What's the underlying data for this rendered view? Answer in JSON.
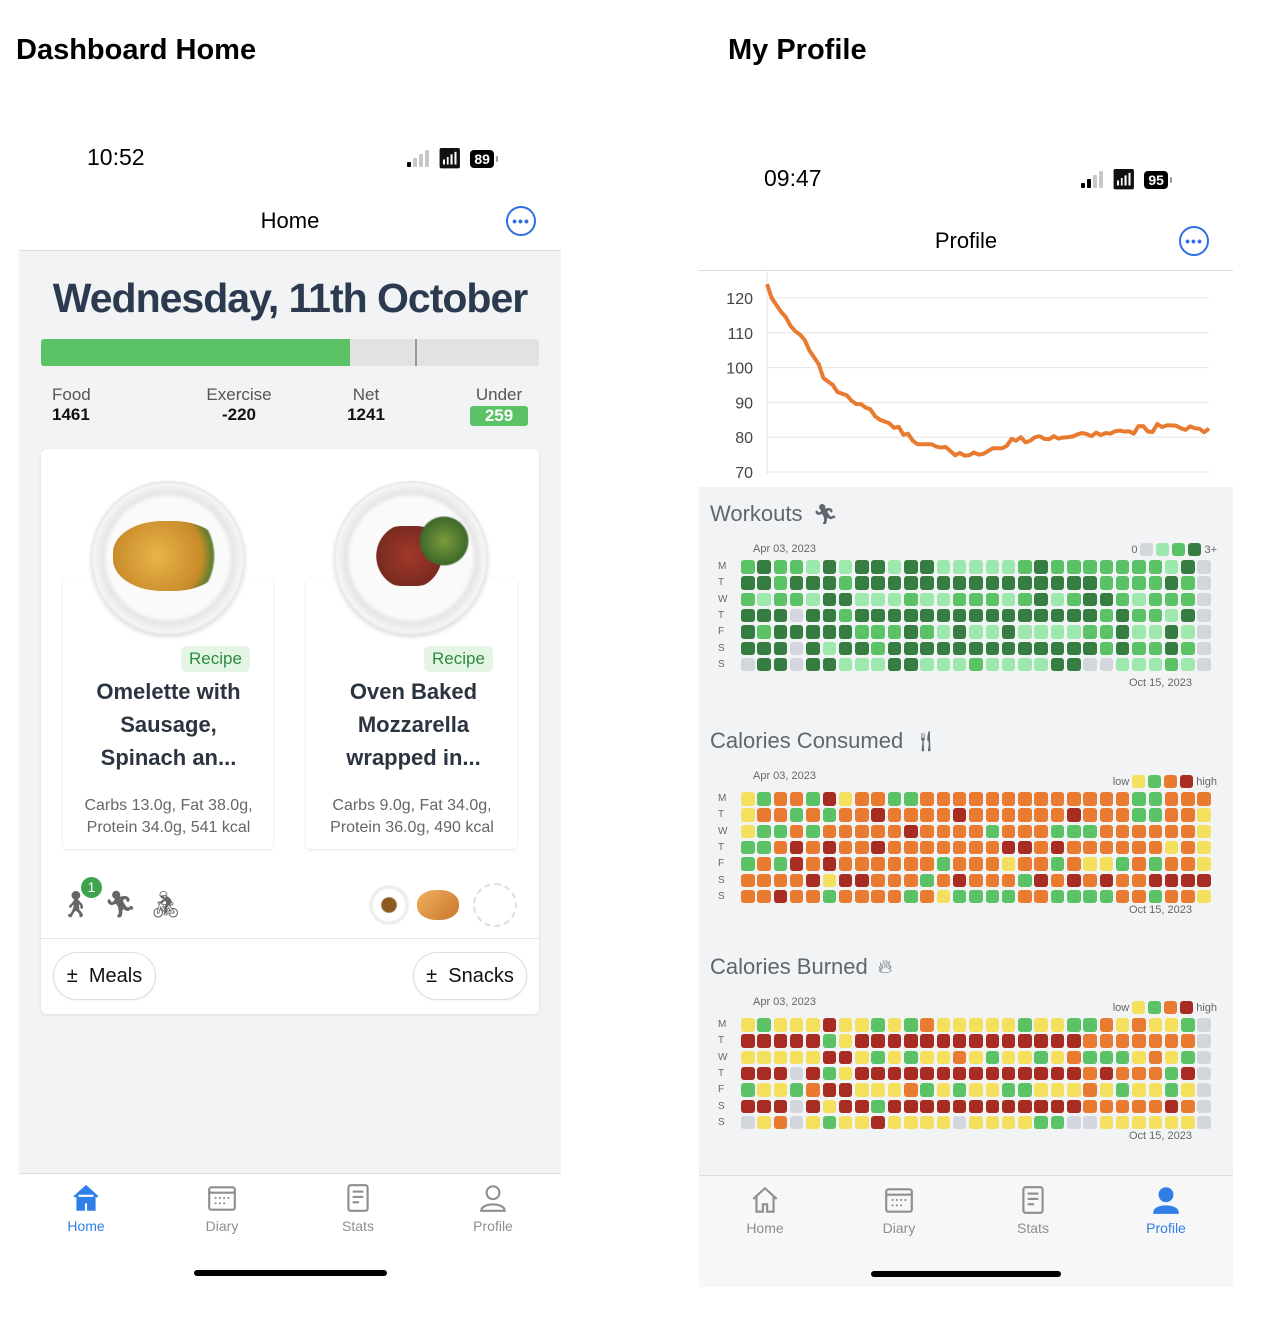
{
  "page_titles": {
    "left": "Dashboard Home",
    "right": "My Profile"
  },
  "home": {
    "status": {
      "time": "10:52",
      "battery": "89"
    },
    "nav_title": "Home",
    "date_title": "Wednesday, 11th October",
    "progress": {
      "food_fraction": 0.62,
      "goal_marker_fraction": 0.75
    },
    "stats": [
      {
        "label": "Food",
        "value": "1461"
      },
      {
        "label": "Exercise",
        "value": "-220"
      },
      {
        "label": "Net",
        "value": "1241"
      },
      {
        "label": "Under",
        "value": "259"
      }
    ],
    "meals": [
      {
        "badge": "Recipe",
        "title": "Omelette with Sausage, Spinach an...",
        "macros": "Carbs 13.0g, Fat 38.0g, Protein 34.0g, 541 kcal"
      },
      {
        "badge": "Recipe",
        "title": "Oven Baked Mozzarella wrapped in...",
        "macros": "Carbs 9.0g, Fat 34.0g, Protein 36.0g, 490 kcal"
      }
    ],
    "activity_badge": "1",
    "activity_icons": [
      "walking-icon",
      "running-icon",
      "cycling-icon"
    ],
    "snack_icons": [
      "coffee-icon",
      "pastry-icon",
      "empty-slot-icon"
    ],
    "buttons": {
      "meals": "Meals",
      "snacks": "Snacks",
      "plusminus": "±"
    },
    "tabs": [
      {
        "label": "Home",
        "icon": "home-icon",
        "active": true
      },
      {
        "label": "Diary",
        "icon": "calendar-icon"
      },
      {
        "label": "Stats",
        "icon": "document-icon"
      },
      {
        "label": "Profile",
        "icon": "person-icon"
      }
    ]
  },
  "profile": {
    "status": {
      "time": "09:47",
      "battery": "95"
    },
    "nav_title": "Profile",
    "tabs": [
      {
        "label": "Home",
        "icon": "home-icon"
      },
      {
        "label": "Diary",
        "icon": "calendar-icon"
      },
      {
        "label": "Stats",
        "icon": "document-icon"
      },
      {
        "label": "Profile",
        "icon": "person-icon",
        "active": true
      }
    ],
    "day_labels": [
      "M",
      "T",
      "W",
      "T",
      "F",
      "S",
      "S"
    ],
    "heatmaps": [
      {
        "title": "Workouts",
        "icon": "running-icon",
        "start": "Apr 03, 2023",
        "end": "Oct 15, 2023",
        "legend_low": "0",
        "legend_high": "3+",
        "palette": [
          "#d3d6dc",
          "#9de8ad",
          "#5cc266",
          "#367d42"
        ],
        "rows": [
          "23221313313311111232222222130",
          "33233323333333333333332222320",
          "21221331112112221231233212220",
          "33303323333333333333332322130",
          "32333332223213113111122311310",
          "33303133233333333333332322320",
          "03303311133111211113300111210"
        ]
      },
      {
        "title": "Calories Consumed",
        "icon": "fork-knife-icon",
        "start": "Apr 03, 2023",
        "end": "Oct 15, 2023",
        "legend_low": "low",
        "legend_high": "high",
        "palette": [
          "#d3d6dc",
          "#f5e05e",
          "#5cc266",
          "#e87b30",
          "#a82c22"
        ],
        "rows": [
          "12332413322333333333333322333",
          "13323233433334333333433322331",
          "12232333334333323332223333331",
          "22343433433333334434333333131",
          "23243433333323331332311232331",
          "33334144333234333243434334444",
          "33433233332312222332222332331"
        ]
      },
      {
        "title": "Calories Burned",
        "icon": "flame-icon",
        "start": "Apr 03, 2023",
        "end": "Oct 15, 2023",
        "legend_low": "low",
        "legend_high": "high",
        "palette": [
          "#d3d6dc",
          "#f5e05e",
          "#5cc266",
          "#e87b30",
          "#a82c22"
        ],
        "rows": [
          "12111411212311111211223131120",
          "44444214444444444444433333330",
          "11111441212113121121322213120",
          "44404214444444444444434333240",
          "21123441113212112211131211210",
          "44404144244444444444433333430",
          "01301211411110111122001111110"
        ]
      }
    ]
  },
  "chart_data": {
    "type": "line",
    "title": "",
    "xlabel": "",
    "ylabel": "",
    "ylim": [
      70,
      124
    ],
    "yticks": [
      70,
      80,
      90,
      100,
      110,
      120
    ],
    "grid": true,
    "color": "#e87b30",
    "values": [
      124,
      120,
      118,
      116,
      114.5,
      112,
      110.5,
      109.5,
      108,
      105,
      103,
      101,
      97,
      96,
      95,
      93,
      92.5,
      92,
      90.5,
      89.5,
      89.5,
      88.5,
      88,
      86,
      85,
      84.5,
      84,
      82.7,
      83,
      80.7,
      81,
      79,
      78,
      78,
      78,
      78,
      77.3,
      77,
      77.2,
      76,
      74.8,
      75.5,
      74.7,
      74.8,
      75.6,
      75,
      75.2,
      76,
      76.8,
      76.8,
      76.8,
      77.5,
      79.5,
      79,
      80,
      78.5,
      79,
      80,
      80.3,
      79.5,
      79.4,
      80.3,
      79.6,
      79.9,
      80,
      80.2,
      80.8,
      81.2,
      80.9,
      80.3,
      81.3,
      80.6,
      81.2,
      81,
      81.7,
      81.9,
      81.6,
      81.7,
      81,
      83.2,
      83.2,
      81.6,
      81.5,
      83.8,
      82.9,
      83.4,
      83.4,
      83.3,
      82.6,
      82.1,
      83.1,
      82.6,
      82.4,
      81.4,
      82.5
    ]
  }
}
